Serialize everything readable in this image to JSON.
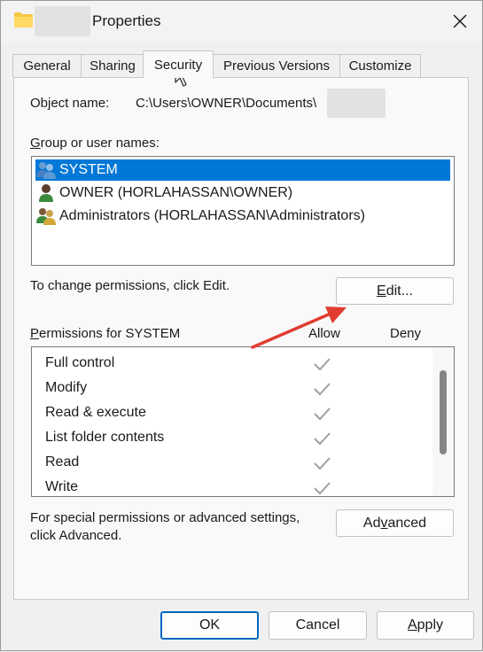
{
  "window": {
    "title": "Properties",
    "close_glyph": "✕"
  },
  "tabs": [
    {
      "label": "General"
    },
    {
      "label": "Sharing"
    },
    {
      "label": "Security",
      "active": true
    },
    {
      "label": "Previous Versions"
    },
    {
      "label": "Customize"
    }
  ],
  "security": {
    "object_name_label": "Object name:",
    "object_name_value": "C:\\Users\\OWNER\\Documents\\",
    "group_label_accel": "G",
    "group_label_rest": "roup or user names:",
    "users": [
      {
        "name": "SYSTEM",
        "icon": "users-group-icon",
        "selected": true
      },
      {
        "name": "OWNER (HORLAHASSAN\\OWNER)",
        "icon": "user-icon",
        "selected": false
      },
      {
        "name": "Administrators (HORLAHASSAN\\Administrators)",
        "icon": "users-group-icon",
        "selected": false
      }
    ],
    "change_text": "To change permissions, click Edit.",
    "edit_button": {
      "accel": "E",
      "rest": "dit..."
    },
    "permissions_label_accel": "P",
    "permissions_label_rest": "ermissions for SYSTEM",
    "allow_label": "Allow",
    "deny_label": "Deny",
    "permissions": [
      {
        "name": "Full control",
        "allow": true,
        "deny": false
      },
      {
        "name": "Modify",
        "allow": true,
        "deny": false
      },
      {
        "name": "Read & execute",
        "allow": true,
        "deny": false
      },
      {
        "name": "List folder contents",
        "allow": true,
        "deny": false
      },
      {
        "name": "Read",
        "allow": true,
        "deny": false
      },
      {
        "name": "Write",
        "allow": true,
        "deny": false
      }
    ],
    "advanced_text_line1": "For special permissions or advanced settings,",
    "advanced_text_line2": "click Advanced.",
    "advanced_button": {
      "pre": "Ad",
      "accel": "v",
      "rest": "anced"
    }
  },
  "footer": {
    "ok_label": "OK",
    "cancel_label": "Cancel",
    "apply_button": {
      "accel": "A",
      "rest": "pply"
    }
  },
  "colors": {
    "selection": "#0078d7",
    "annotation_arrow": "#e03c31",
    "check_disabled": "#a0a0a0"
  }
}
